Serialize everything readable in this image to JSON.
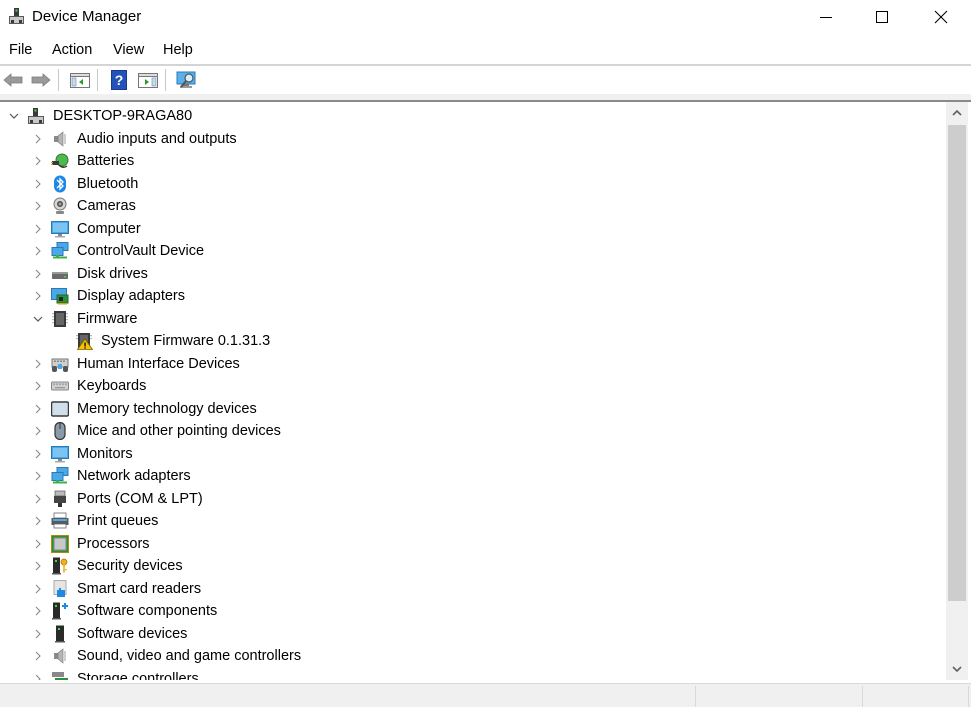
{
  "window": {
    "title": "Device Manager",
    "controls": {
      "minimize": "minimize-icon",
      "maximize": "maximize-icon",
      "close": "close-icon"
    }
  },
  "menu": [
    "File",
    "Action",
    "View",
    "Help"
  ],
  "toolbar": {
    "buttons": [
      {
        "name": "back-button",
        "icon": "arrow-left-icon"
      },
      {
        "name": "forward-button",
        "icon": "arrow-right-icon"
      },
      {
        "name": "show-hide-console-tree-button",
        "icon": "console-tree-icon"
      },
      {
        "name": "help-button",
        "icon": "help-icon"
      },
      {
        "name": "show-hide-action-pane-button",
        "icon": "action-pane-icon"
      },
      {
        "name": "scan-hardware-changes-button",
        "icon": "scan-monitor-icon"
      }
    ]
  },
  "tree": {
    "root": {
      "label": "DESKTOP-9RAGA80",
      "icon": "computer-tower-icon",
      "expanded": true
    },
    "items": [
      {
        "label": "Audio inputs and outputs",
        "icon": "speaker-icon",
        "expanded": false
      },
      {
        "label": "Batteries",
        "icon": "battery-plug-icon",
        "expanded": false
      },
      {
        "label": "Bluetooth",
        "icon": "bluetooth-icon",
        "expanded": false
      },
      {
        "label": "Cameras",
        "icon": "webcam-icon",
        "expanded": false
      },
      {
        "label": "Computer",
        "icon": "monitor-icon",
        "expanded": false
      },
      {
        "label": "ControlVault Device",
        "icon": "network-icon",
        "expanded": false
      },
      {
        "label": "Disk drives",
        "icon": "disk-drive-icon",
        "expanded": false
      },
      {
        "label": "Display adapters",
        "icon": "display-adapter-icon",
        "expanded": false
      },
      {
        "label": "Firmware",
        "icon": "chip-icon",
        "expanded": true,
        "children": [
          {
            "label": "System Firmware 0.1.31.3",
            "icon": "chip-warning-icon"
          }
        ]
      },
      {
        "label": "Human Interface Devices",
        "icon": "hid-icon",
        "expanded": false
      },
      {
        "label": "Keyboards",
        "icon": "keyboard-icon",
        "expanded": false
      },
      {
        "label": "Memory technology devices",
        "icon": "memory-card-icon",
        "expanded": false
      },
      {
        "label": "Mice and other pointing devices",
        "icon": "mouse-icon",
        "expanded": false
      },
      {
        "label": "Monitors",
        "icon": "monitor-icon",
        "expanded": false
      },
      {
        "label": "Network adapters",
        "icon": "network-icon",
        "expanded": false
      },
      {
        "label": "Ports (COM & LPT)",
        "icon": "port-icon",
        "expanded": false
      },
      {
        "label": "Print queues",
        "icon": "printer-icon",
        "expanded": false
      },
      {
        "label": "Processors",
        "icon": "processor-icon",
        "expanded": false
      },
      {
        "label": "Security devices",
        "icon": "security-key-icon",
        "expanded": false
      },
      {
        "label": "Smart card readers",
        "icon": "smart-card-icon",
        "expanded": false
      },
      {
        "label": "Software components",
        "icon": "software-component-icon",
        "expanded": false
      },
      {
        "label": "Software devices",
        "icon": "software-device-icon",
        "expanded": false
      },
      {
        "label": "Sound, video and game controllers",
        "icon": "speaker-icon",
        "expanded": false
      },
      {
        "label": "Storage controllers",
        "icon": "storage-controller-icon",
        "expanded": false
      }
    ]
  },
  "colors": {
    "accent_blue": "#1e88e5",
    "green": "#3cb043",
    "warning": "#f5c400"
  }
}
